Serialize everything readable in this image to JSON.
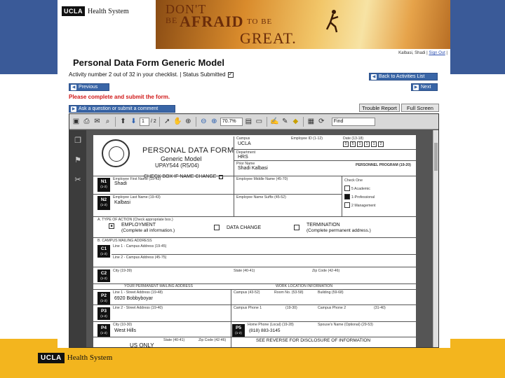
{
  "banner": {
    "logo_ucla": "UCLA",
    "logo_hs": "Health System",
    "slogan_1": "DON'T",
    "slogan_2": "BE",
    "slogan_3": "AFRAID",
    "slogan_4": "TO BE",
    "slogan_5": "GREAT."
  },
  "page": {
    "title": "Personal Data Form Generic Model",
    "user_name": "Kalbasi, Shadi",
    "sign_out_label": "Sign Out",
    "status_text": "Activity number 2 out of 32 in your checklist. | Status Submitted",
    "back_label": "Back to Activities List",
    "previous_label": "Previous",
    "next_label": "Next",
    "error": "Please complete and submit the form.",
    "ask_label": "Ask a question or submit a comment",
    "trouble_label": "Trouble Report",
    "fullscreen_label": "Full Screen"
  },
  "viewer": {
    "page_input": "1",
    "page_total": "/ 2",
    "zoom": "70.7%",
    "find_input": "Find"
  },
  "form": {
    "title": "PERSONAL DATA FORM",
    "subtitle": "Generic Model",
    "code": "UPAY544 (R5/04)",
    "check_name_change": "CHECK BOX IF NAME CHANGE",
    "campus_label": "Campus",
    "campus_value": "UCLA",
    "employee_id_label": "Employee ID (1-12)",
    "date_label": "Date (13-18)",
    "date_boxes": [
      "0",
      "5",
      "1",
      "1",
      "1",
      "2"
    ],
    "department_label": "Department",
    "department_value": "HRS",
    "prior_name_label": "Prior Name",
    "prior_name_value": "Shadi Kalbasi",
    "personnel_program_label": "PERSONNEL PROGRAM (19-20)",
    "check_one": "Check One",
    "program_options": [
      "5 Academic",
      "1-Professional",
      "2 Management"
    ],
    "first_name_label": "Employee First Name (19-43)",
    "first_name_value": "Shadi",
    "middle_name_label": "Employee Middle Name (45-70)",
    "last_name_label": "Employee Last Name (19-43)",
    "last_name_value": "Kalbasi",
    "suffix_label": "Employee Name Suffix (45-52)",
    "section_a": "A. TYPE OF ACTION (Check appropriate box.)",
    "employment": "EMPLOYMENT",
    "employment_note": "(Complete all information.)",
    "data_change": "DATA CHANGE",
    "termination": "TERMINATION",
    "termination_note": "(Complete permanent address.)",
    "section_b": "B. CAMPUS MAILING ADDRESS",
    "line1_label": "Line 1 - Campus Address (19-45)",
    "line2_label": "Line 2 - Campus Address (45-75)",
    "city_label": "City (19-39)",
    "state_label": "State (40-41)",
    "zip_label": "Zip Code (42-46)",
    "permanent_header": "YOUR PERMANENT MAILING ADDRESS",
    "work_header": "WORK LOCATION INFORMATION",
    "street1_label": "Line 1 - Street Address (19-48)",
    "street1_value": "6920 Bobbyboyar",
    "street2_label": "Line 2 - Street Address (19-40)",
    "city2_label": "City (10-30)",
    "city2_value": "West Hills",
    "state2_label": "State (40-41)",
    "zip2_label": "Zip Code (42-46)",
    "campus2_label": "Campus (43-52)",
    "room_label": "Room No. (53-58)",
    "building_label": "Building (59-68)",
    "campus_phone1_label": "Campus Phone 1",
    "campus_phone1_ext": "(19-30)",
    "campus_phone2_label": "Campus Phone 2",
    "campus_phone2_ext": "(31-40)",
    "home_phone_label": "Home Phone (Local) (19-28)",
    "home_phone_value": "(818) 883-3145",
    "spouse_label": "Spouse's Name (Optional) (29-53)",
    "us_only": "US ONLY",
    "see_reverse": "SEE REVERSE FOR DISCLOSURE OF INFORMATION",
    "tags": [
      {
        "code": "N1",
        "range": "(1-2)"
      },
      {
        "code": "N2",
        "range": "(1-2)"
      },
      {
        "code": "C1",
        "range": "(1-2)"
      },
      {
        "code": "C2",
        "range": "(1-2)"
      },
      {
        "code": "P2",
        "range": "(1-2)"
      },
      {
        "code": "P3",
        "range": "(1-2)"
      },
      {
        "code": "P4",
        "range": "(1-2)"
      },
      {
        "code": "P5",
        "range": "(1-2)"
      }
    ]
  },
  "footer": {
    "logo_ucla": "UCLA",
    "logo_hs": "Health System"
  },
  "colors": {
    "slide_blue": "#3a5a98",
    "footer_gold": "#f3b51e",
    "button_blue": "#3965a6",
    "error_red": "#d01818"
  }
}
